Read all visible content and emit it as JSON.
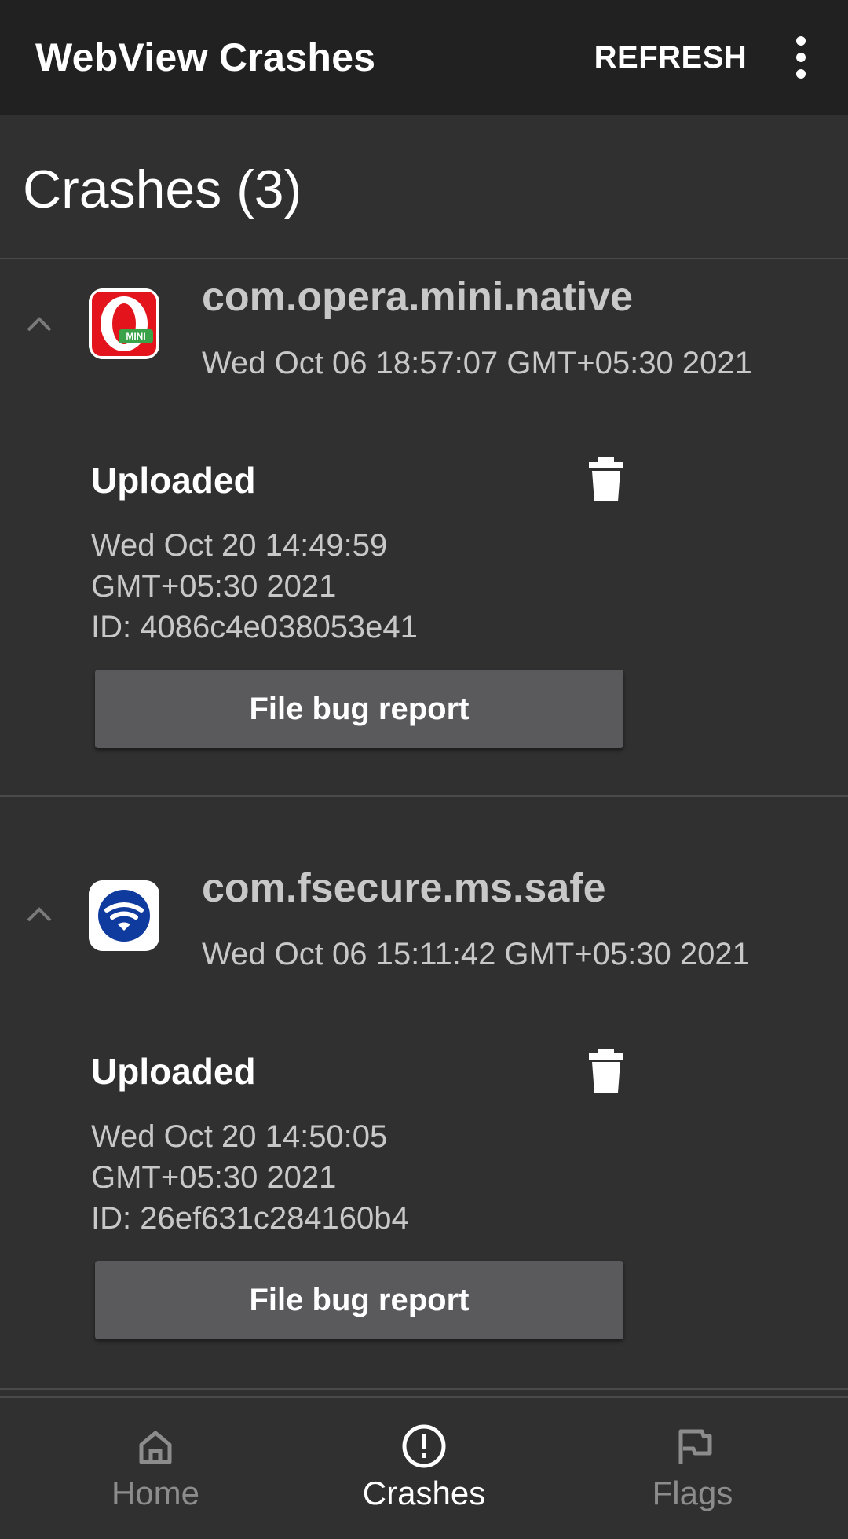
{
  "app_bar": {
    "title": "WebView Crashes",
    "refresh_label": "REFRESH",
    "overflow_icon": "more-vert-icon"
  },
  "section": {
    "title": "Crashes (3)"
  },
  "crashes": [
    {
      "package": "com.opera.mini.native",
      "crash_time": "Wed Oct 06 18:57:07 GMT+05:30 2021",
      "status": "Uploaded",
      "upload_time_line1": "Wed Oct 20 14:49:59",
      "upload_time_line2": "GMT+05:30 2021",
      "id_line": "ID: 4086c4e038053e41",
      "button_label": "File bug report",
      "icon": "opera-mini-app-icon",
      "icon_badge": "MINI"
    },
    {
      "package": "com.fsecure.ms.safe",
      "crash_time": "Wed Oct 06 15:11:42 GMT+05:30 2021",
      "status": "Uploaded",
      "upload_time_line1": "Wed Oct 20 14:50:05",
      "upload_time_line2": "GMT+05:30 2021",
      "id_line": "ID: 26ef631c284160b4",
      "button_label": "File bug report",
      "icon": "fsecure-safe-app-icon"
    }
  ],
  "bottom_nav": {
    "items": [
      {
        "label": "Home",
        "icon": "home-icon",
        "active": false
      },
      {
        "label": "Crashes",
        "icon": "alert-circle-icon",
        "active": true
      },
      {
        "label": "Flags",
        "icon": "flag-icon",
        "active": false
      }
    ]
  },
  "colors": {
    "app_bar": "#212121",
    "background": "#303030",
    "button": "#5a5a5c",
    "secondary_text": "#c8c8c8",
    "opera_red": "#e3141c",
    "fsecure_blue": "#0f3a9e"
  }
}
